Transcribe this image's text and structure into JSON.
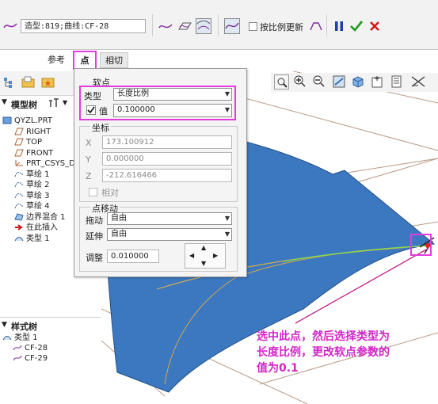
{
  "toolbar": {
    "field_text": "造型:819;曲线:CF-28",
    "proportional_update_label": "按比例更新"
  },
  "tabs": [
    {
      "label": "参考"
    },
    {
      "label": "点"
    },
    {
      "label": "相切"
    }
  ],
  "model_tree": {
    "title": "模型树",
    "items": [
      {
        "label": "QYZL.PRT",
        "icon": "part-icon"
      },
      {
        "label": "RIGHT",
        "icon": "datum-plane-icon"
      },
      {
        "label": "TOP",
        "icon": "datum-plane-icon"
      },
      {
        "label": "FRONT",
        "icon": "datum-plane-icon"
      },
      {
        "label": "PRT_CSYS_D",
        "icon": "csys-icon"
      },
      {
        "label": "草绘 1",
        "icon": "sketch-icon"
      },
      {
        "label": "草绘 2",
        "icon": "sketch-icon"
      },
      {
        "label": "草绘 3",
        "icon": "sketch-icon"
      },
      {
        "label": "草绘 4",
        "icon": "sketch-icon"
      },
      {
        "label": "边界混合 1",
        "icon": "boundary-blend-icon"
      },
      {
        "label": "在此插入",
        "icon": "insert-arrow-icon"
      },
      {
        "label": "类型 1",
        "icon": "style-feature-icon"
      }
    ]
  },
  "style_tree": {
    "title": "样式树",
    "items": [
      {
        "label": "类型 1"
      },
      {
        "label": "CF-28"
      },
      {
        "label": "CF-29"
      }
    ]
  },
  "dialog": {
    "soft_point": {
      "title": "软点",
      "type_label": "类型",
      "type_value": "长度比例",
      "value_label": "值",
      "value_checked": true,
      "value_value": "0.100000"
    },
    "coords": {
      "title": "坐标",
      "x_label": "X",
      "x_value": "173.100912",
      "y_label": "Y",
      "y_value": "0.000000",
      "z_label": "Z",
      "z_value": "-212.616466",
      "relative_label": "相对"
    },
    "point_move": {
      "title": "点移动",
      "drag_label": "拖动",
      "drag_value": "自由",
      "extend_label": "延伸",
      "extend_value": "自由",
      "adjust_label": "调整",
      "adjust_value": "0.010000"
    }
  },
  "annotation": {
    "line1": "选中此点，然后选择类型为",
    "line2": "长度比例，更改软点参数的",
    "line3": "值为0.1"
  },
  "colors": {
    "surface": "#3c78c0",
    "accent_pink": "#e33ce0",
    "annotation_text": "#d126c8",
    "confirm_green": "#1a9a1a",
    "cancel_red": "#d11a1a",
    "pause_blue": "#1f3ea8"
  }
}
